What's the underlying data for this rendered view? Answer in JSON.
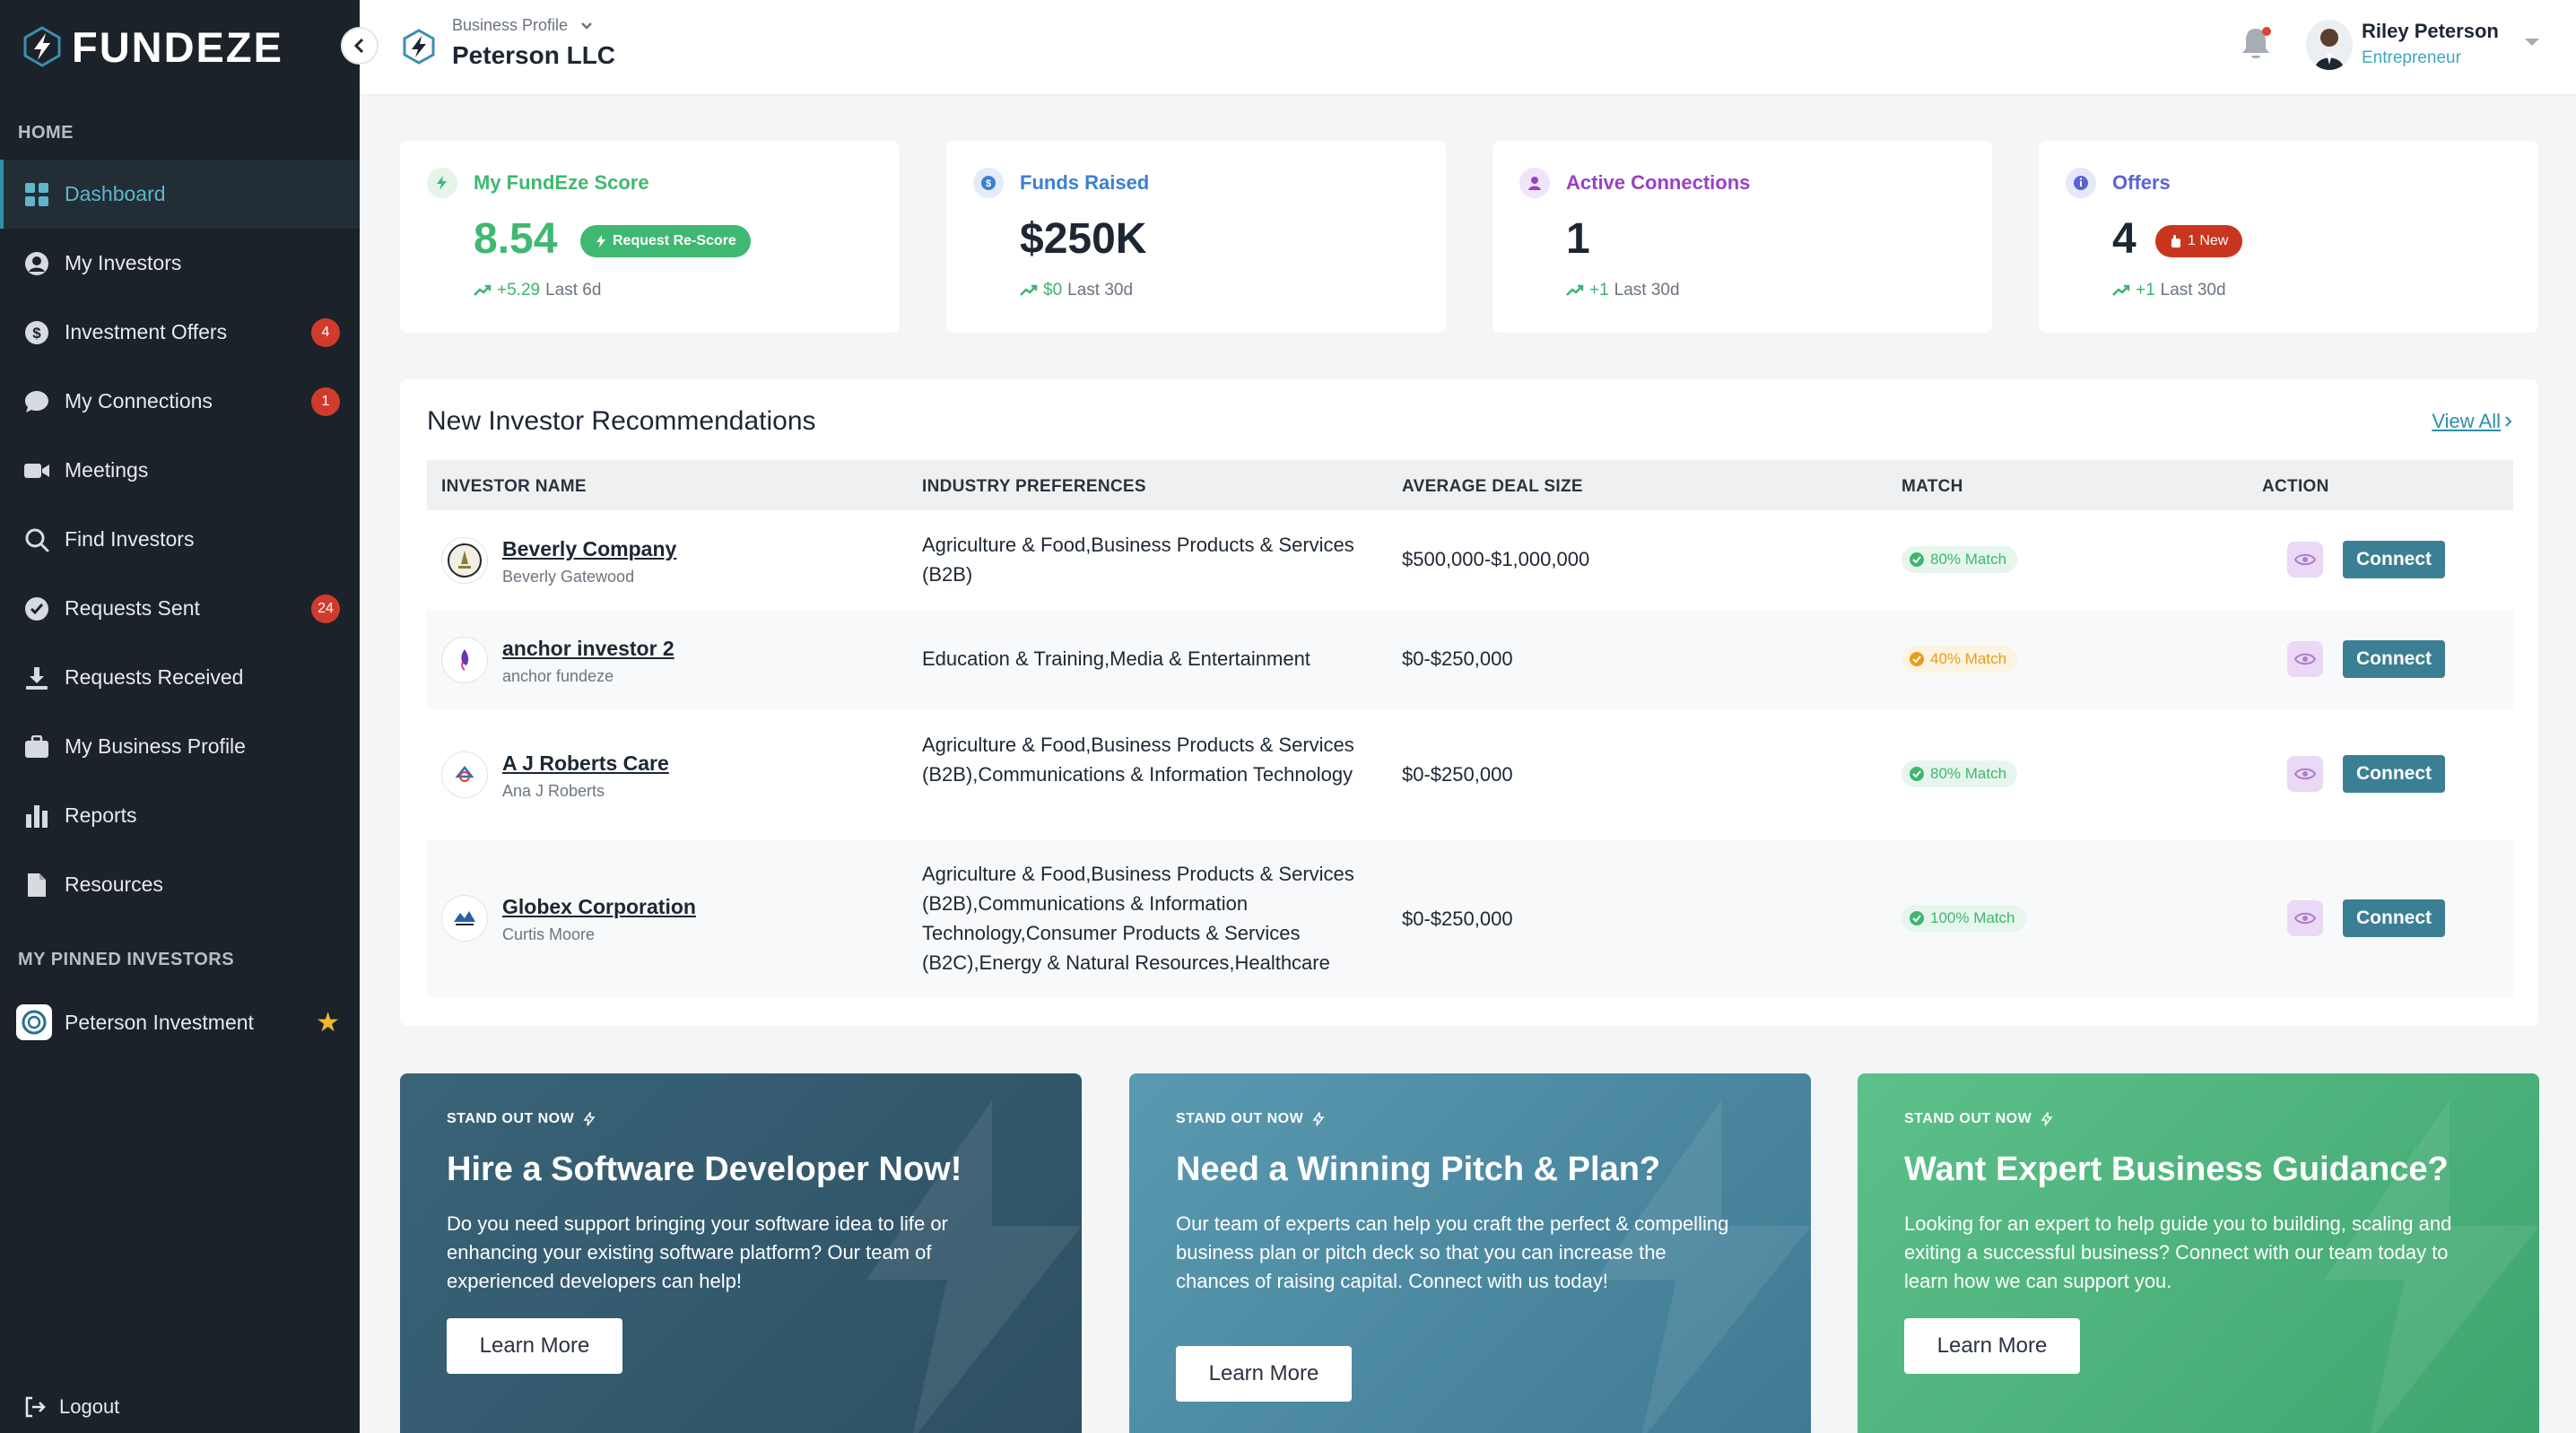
{
  "brand": {
    "name": "FUNDEZE"
  },
  "sidebar": {
    "home_label": "HOME",
    "items": [
      {
        "label": "Dashboard",
        "icon": "grid-icon",
        "badge": "",
        "active": true
      },
      {
        "label": "My Investors",
        "icon": "user-circle-icon",
        "badge": ""
      },
      {
        "label": "Investment Offers",
        "icon": "dollar-icon",
        "badge": "4"
      },
      {
        "label": "My Connections",
        "icon": "chat-icon",
        "badge": "1"
      },
      {
        "label": "Meetings",
        "icon": "video-icon",
        "badge": ""
      },
      {
        "label": "Find Investors",
        "icon": "search-icon",
        "badge": ""
      },
      {
        "label": "Requests Sent",
        "icon": "check-circle-icon",
        "badge": "24"
      },
      {
        "label": "Requests Received",
        "icon": "download-icon",
        "badge": ""
      },
      {
        "label": "My Business Profile",
        "icon": "briefcase-icon",
        "badge": ""
      },
      {
        "label": "Reports",
        "icon": "bar-chart-icon",
        "badge": ""
      },
      {
        "label": "Resources",
        "icon": "document-icon",
        "badge": ""
      }
    ],
    "pinned_label": "MY PINNED INVESTORS",
    "pinned": [
      {
        "label": "Peterson Investment"
      }
    ],
    "logout_label": "Logout"
  },
  "header": {
    "kicker": "Business Profile",
    "business_name": "Peterson LLC",
    "user_name": "Riley Peterson",
    "user_role": "Entrepreneur"
  },
  "stats": [
    {
      "title": "My FundEze Score",
      "value": "8.54",
      "pill": "Request Re-Score",
      "trend_num": "+5.29",
      "trend_label": "Last 6d",
      "color": "#3fb871"
    },
    {
      "title": "Funds Raised",
      "value": "$250K",
      "trend_num": "$0",
      "trend_label": "Last 30d",
      "color": "#3b7fd4"
    },
    {
      "title": "Active Connections",
      "value": "1",
      "trend_num": "+1",
      "trend_label": "Last 30d",
      "color": "#9a3fc8"
    },
    {
      "title": "Offers",
      "value": "4",
      "pill": "1 New",
      "trend_num": "+1",
      "trend_label": "Last 30d",
      "color": "#5a62d6"
    }
  ],
  "recommendations": {
    "title": "New Investor Recommendations",
    "view_all": "View All",
    "columns": [
      "INVESTOR NAME",
      "INDUSTRY PREFERENCES",
      "AVERAGE DEAL SIZE",
      "MATCH",
      "ACTION"
    ],
    "rows": [
      {
        "name": "Beverly Company",
        "contact": "Beverly Gatewood",
        "industry": "Agriculture & Food,Business Products & Services (B2B)",
        "deal": "$500,000-$1,000,000",
        "match": "80% Match",
        "match_tone": "green",
        "action": "Connect"
      },
      {
        "name": "anchor investor 2",
        "contact": "anchor fundeze",
        "industry": "Education & Training,Media & Entertainment",
        "deal": "$0-$250,000",
        "match": "40% Match",
        "match_tone": "amber",
        "action": "Connect"
      },
      {
        "name": "A J Roberts Care",
        "contact": "Ana J Roberts",
        "industry": "Agriculture & Food,Business Products & Services (B2B),Communications & Information Technology",
        "deal": "$0-$250,000",
        "match": "80% Match",
        "match_tone": "green",
        "action": "Connect"
      },
      {
        "name": "Globex Corporation",
        "contact": "Curtis Moore",
        "industry": "Agriculture & Food,Business Products & Services (B2B),Communications & Information Technology,Consumer Products & Services (B2C),Energy & Natural Resources,Healthcare",
        "deal": "$0-$250,000",
        "match": "100% Match",
        "match_tone": "green",
        "action": "Connect"
      }
    ]
  },
  "promos": [
    {
      "kicker": "STAND OUT NOW",
      "title": "Hire a Software Developer Now!",
      "text": "Do you need support bringing your software idea to life or enhancing your existing software platform? Our team of experienced developers can help!",
      "button": "Learn More"
    },
    {
      "kicker": "STAND OUT NOW",
      "title": "Need a Winning Pitch & Plan?",
      "text": "Our team of experts can help you craft the perfect & compelling business plan or pitch deck so that you can increase the chances of raising capital. Connect with us today!",
      "button": "Learn More"
    },
    {
      "kicker": "STAND OUT NOW",
      "title": "Want Expert Business Guidance?",
      "text": "Looking for an expert to help guide you to building, scaling and exiting a successful business? Connect with our team today to learn how we can support you.",
      "button": "Learn More"
    }
  ]
}
